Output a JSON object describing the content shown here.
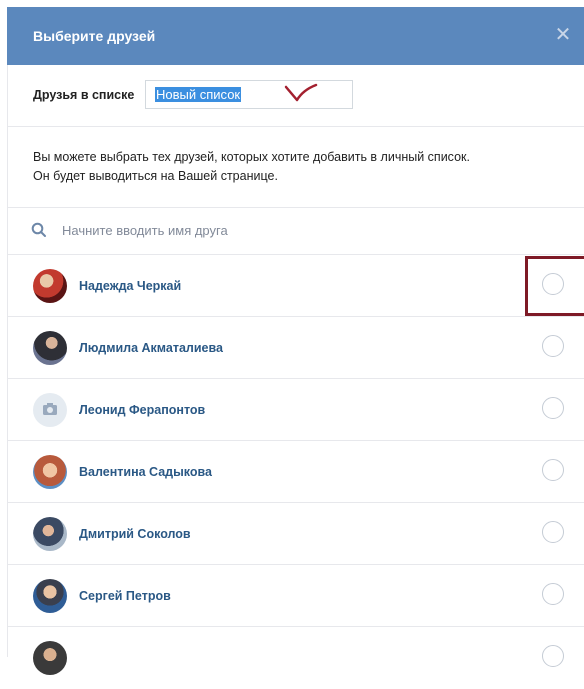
{
  "dialog": {
    "title": "Выберите друзей",
    "close_icon": "close-icon"
  },
  "list_name": {
    "label": "Друзья в списке",
    "value": "Новый список"
  },
  "info": {
    "line1": "Вы можете выбрать тех друзей, которых хотите добавить в личный список.",
    "line2": "Он будет выводиться на Вашей странице."
  },
  "search": {
    "placeholder": "Начните вводить имя друга"
  },
  "friends": [
    {
      "name": "Надежда Черкай",
      "avatar": "photo",
      "avatar_color": "#8c1f24",
      "checked": false
    },
    {
      "name": "Людмила Акматалиева",
      "avatar": "photo",
      "avatar_color": "#3a3f4a",
      "checked": false
    },
    {
      "name": "Леонид Ферапонтов",
      "avatar": "camera-icon",
      "avatar_color": "#e5ebf1",
      "checked": false
    },
    {
      "name": "Валентина Садыкова",
      "avatar": "photo",
      "avatar_color": "#b86a55",
      "checked": false
    },
    {
      "name": "Дмитрий Соколов",
      "avatar": "photo",
      "avatar_color": "#6e7f94",
      "checked": false
    },
    {
      "name": "Сергей Петров",
      "avatar": "photo",
      "avatar_color": "#5a6f8f",
      "checked": false
    },
    {
      "name": "",
      "avatar": "photo",
      "avatar_color": "#4a4a4a",
      "checked": false
    }
  ],
  "colors": {
    "header_bg": "#5b88bd",
    "link": "#2a5885",
    "annotation": "#7e1a26",
    "selection": "#3b8fe0"
  }
}
